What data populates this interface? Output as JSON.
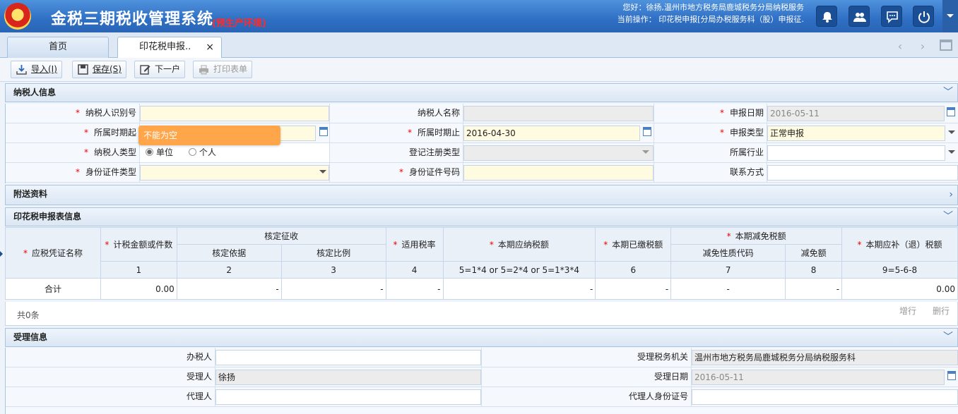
{
  "header": {
    "title": "金税三期税收管理系统",
    "env": "(预生产环境)",
    "greeting": "您好：徐扬,温州市地方税务局鹿城税务分局纳税服务",
    "current_op": "当前操作： 印花税申报[分局办税服务科（股）申报征."
  },
  "tabs": [
    {
      "label": "首页"
    },
    {
      "label": "印花税申报..",
      "close": "×"
    }
  ],
  "nav": {
    "prev": "‹",
    "next": "›"
  },
  "toolbar": {
    "import": "导入(I)",
    "save": "保存(S)",
    "next": "下一户",
    "print": "打印表单"
  },
  "sections": {
    "taxpayer": "纳税人信息",
    "attachments": "附送资料",
    "stamp_table": "印花税申报表信息",
    "acceptance": "受理信息"
  },
  "taxpayer": {
    "id_label": "纳税人识别号",
    "name_label": "纳税人名称",
    "date_label": "申报日期",
    "date_value": "2016-05-11",
    "period_start_label": "所属时期起",
    "period_end_label": "所属时期止",
    "period_end_value": "2016-04-30",
    "decl_type_label": "申报类型",
    "decl_type_value": "正常申报",
    "type_label": "纳税人类型",
    "type_opt1": "单位",
    "type_opt2": "个人",
    "reg_type_label": "登记注册类型",
    "industry_label": "所属行业",
    "idtype_label": "身份证件类型",
    "idno_label": "身份证件号码",
    "contact_label": "联系方式"
  },
  "validation_tip": "不能为空",
  "table": {
    "h_name": "应税凭证名称",
    "h_amount": "计税金额或件数",
    "h_verify": "核定征收",
    "h_basis": "核定依据",
    "h_ratio": "核定比例",
    "h_rate": "适用税率",
    "h_payable": "本期应纳税额",
    "h_paid": "本期已缴税额",
    "h_relief": "本期减免税额",
    "h_relief_code": "减免性质代码",
    "h_relief_amt": "减免额",
    "h_refund": "本期应补（退）税额",
    "idx": [
      "1",
      "2",
      "3",
      "4",
      "5=1*4 or 5=2*4 or 5=1*3*4",
      "6",
      "7",
      "8",
      "9=5-6-8"
    ],
    "total_row": [
      "合计",
      "0.00",
      "-",
      "-",
      "-",
      "-",
      "-",
      "-",
      "-",
      "0.00"
    ],
    "count": "共0条",
    "add_row": "增行",
    "del_row": "删行"
  },
  "acceptance": {
    "handler_label": "办税人",
    "tax_org_label": "受理税务机关",
    "tax_org_value": "温州市地方税务局鹿城税务分局纳税服务科",
    "receiver_label": "受理人",
    "receiver_value": "徐扬",
    "recv_date_label": "受理日期",
    "recv_date_value": "2016-05-11",
    "agent_label": "代理人",
    "agent_id_label": "代理人身份证号"
  }
}
